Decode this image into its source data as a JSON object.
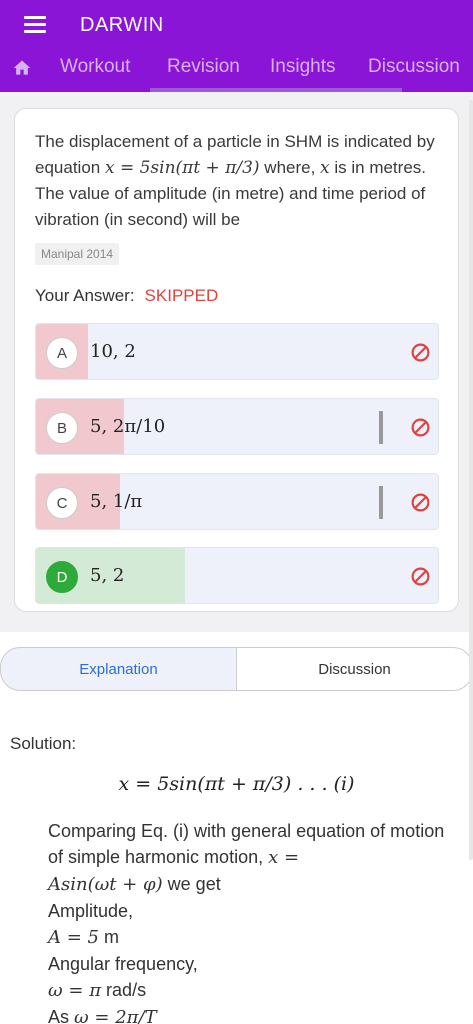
{
  "app": {
    "title": "DARWIN",
    "tabs": [
      "Workout",
      "Revision",
      "Insights",
      "Discussion"
    ],
    "brand_color": "#8a15d6"
  },
  "question": {
    "text_part1": "The displacement of a particle in SHM is indicated by equation ",
    "equation": "x = 5sin(πt + π/3)",
    "text_part2": " where, ",
    "var": "x",
    "text_part3": " is in metres. The value of amplitude (in metre) and time period of vibration (in second) will be",
    "tag": "Manipal 2014",
    "your_answer_label": "Your Answer:",
    "your_answer_status": "SKIPPED"
  },
  "options": [
    {
      "letter": "A",
      "text": "10, 2",
      "fill": 0.13,
      "fill_color": "#f2c8cf",
      "correct": false
    },
    {
      "letter": "B",
      "text": "5, 2π/10",
      "fill": 0.22,
      "fill_color": "#f2c8cf",
      "correct": false
    },
    {
      "letter": "C",
      "text": "5, 1/π",
      "fill": 0.21,
      "fill_color": "#f2c8cf",
      "correct": false
    },
    {
      "letter": "D",
      "text": "5, 2",
      "fill": 0.37,
      "fill_color": "#d3ead6",
      "correct": true
    }
  ],
  "segments": {
    "explanation": "Explanation",
    "discussion": "Discussion"
  },
  "solution": {
    "label": "Solution:",
    "equation": "x = 5sin(πt + π/3) . . . (i)",
    "line1": "Comparing Eq. (i) with general equation of motion of simple harmonic motion, ",
    "line1_eq": "x =",
    "line2_eq": "Asin(ωt + φ)",
    "line2_text": " we get",
    "amplitude_label": "Amplitude,",
    "amplitude_eq": "A = 5",
    "amplitude_unit": " m",
    "angular_label": "Angular frequency,",
    "angular_eq": "ω = π",
    "angular_unit": " rad/s",
    "as_text": "As ",
    "as_eq": "ω = 2π/T"
  }
}
